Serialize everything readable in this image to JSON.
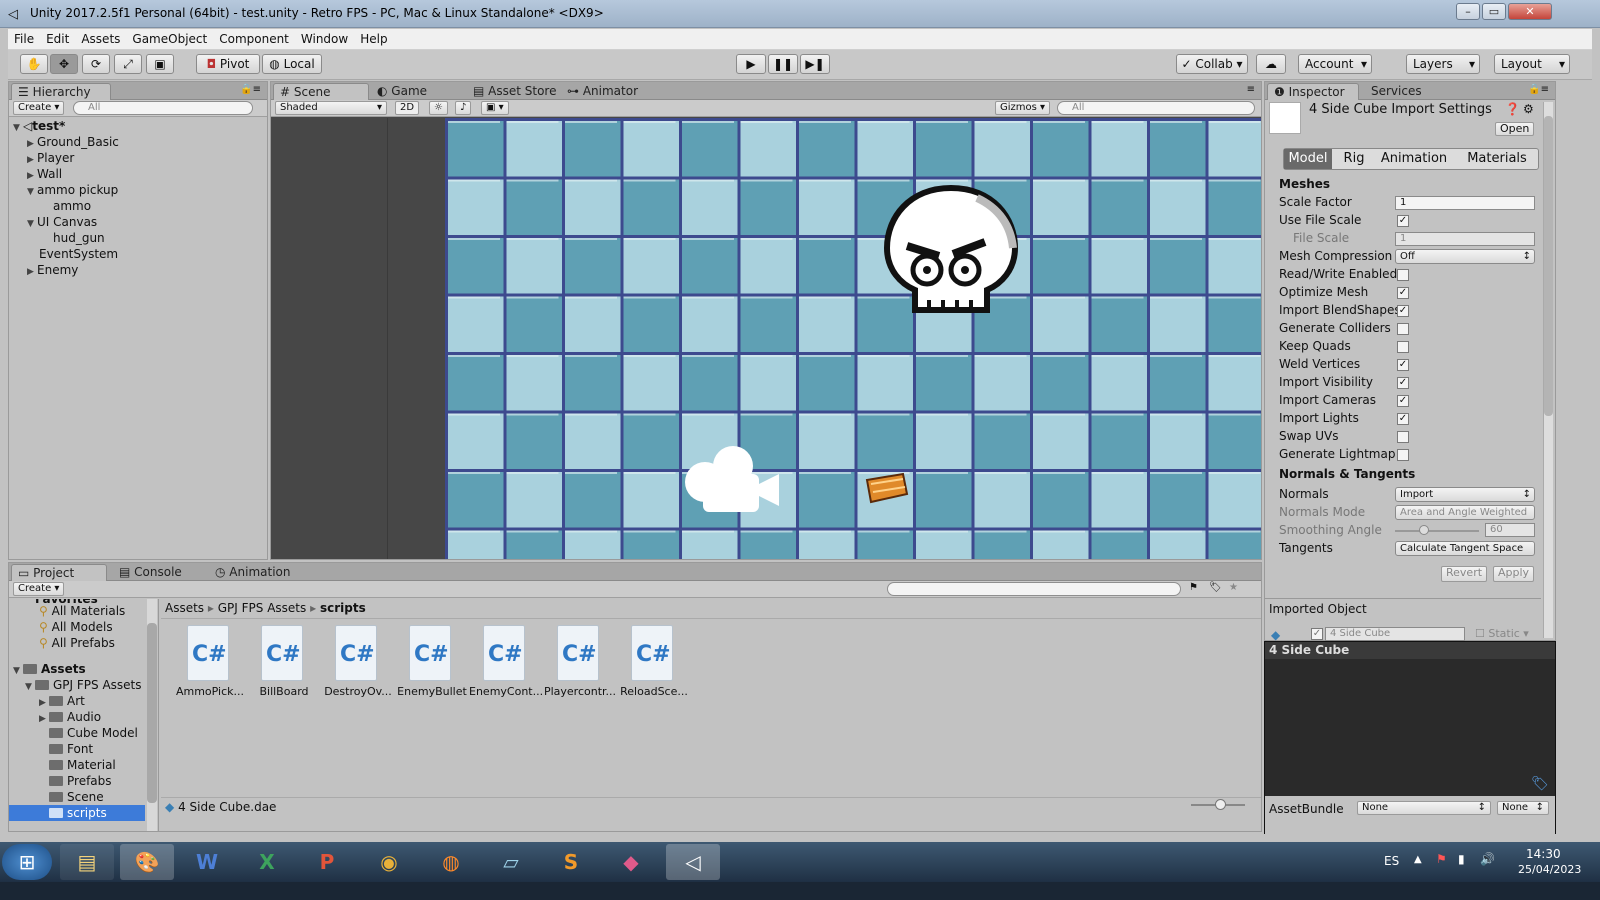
{
  "window": {
    "title": "Unity 2017.2.5f1 Personal (64bit) - test.unity - Retro FPS - PC, Mac & Linux Standalone* <DX9>"
  },
  "menu": [
    "File",
    "Edit",
    "Assets",
    "GameObject",
    "Component",
    "Window",
    "Help"
  ],
  "toolbar": {
    "pivot": "Pivot",
    "local": "Local",
    "collab": "Collab",
    "account": "Account",
    "layers": "Layers",
    "layout": "Layout"
  },
  "hierarchy": {
    "tab": "Hierarchy",
    "create": "Create",
    "search_placeholder": "All",
    "scene": "test*",
    "items": [
      "Ground_Basic",
      "Player",
      "Wall",
      "ammo pickup",
      "ammo",
      "UI Canvas",
      "hud_gun",
      "EventSystem",
      "Enemy"
    ]
  },
  "scene_tabs": {
    "scene": "Scene",
    "game": "Game",
    "store": "Asset Store",
    "animator": "Animator"
  },
  "scene_toolbar": {
    "shaded": "Shaded",
    "mode2d": "2D",
    "gizmos": "Gizmos",
    "search_placeholder": "All"
  },
  "inspector": {
    "tab": "Inspector",
    "services": "Services",
    "title": "4 Side Cube Import Settings",
    "open": "Open",
    "subtabs": [
      "Model",
      "Rig",
      "Animation",
      "Materials"
    ],
    "meshes_header": "Meshes",
    "scale_factor_label": "Scale Factor",
    "scale_factor_value": "1",
    "use_file_scale_label": "Use File Scale",
    "use_file_scale": true,
    "file_scale_label": "File Scale",
    "file_scale_value": "1",
    "mesh_compression_label": "Mesh Compression",
    "mesh_compression_value": "Off",
    "rw_label": "Read/Write Enabled",
    "rw": false,
    "optimize_label": "Optimize Mesh",
    "optimize": true,
    "blend_label": "Import BlendShapes",
    "blend": true,
    "colliders_label": "Generate Colliders",
    "colliders": false,
    "quads_label": "Keep Quads",
    "quads": false,
    "weld_label": "Weld Vertices",
    "weld": true,
    "visibility_label": "Import Visibility",
    "visibility": true,
    "cameras_label": "Import Cameras",
    "cameras": true,
    "lights_label": "Import Lights",
    "lights": true,
    "swap_label": "Swap UVs",
    "swap": false,
    "lightmap_label": "Generate Lightmap U",
    "lightmap": false,
    "normals_header": "Normals & Tangents",
    "normals_label": "Normals",
    "normals_value": "Import",
    "normals_mode_label": "Normals Mode",
    "normals_mode_value": "Area and Angle Weighted",
    "smoothing_label": "Smoothing Angle",
    "smoothing_value": "60",
    "tangents_label": "Tangents",
    "tangents_value": "Calculate Tangent Space",
    "revert": "Revert",
    "apply": "Apply",
    "imported_object": "Imported Object",
    "object_name": "4 Side Cube",
    "static": "Static",
    "preview_title": "4 Side Cube",
    "assetbundle_label": "AssetBundle",
    "assetbundle_value": "None",
    "assetbundle_variant": "None"
  },
  "project": {
    "tabs": [
      "Project",
      "Console",
      "Animation"
    ],
    "create": "Create",
    "favorites_header": "Favorites",
    "favorites": [
      "All Materials",
      "All Models",
      "All Prefabs"
    ],
    "assets_header": "Assets",
    "gpj": "GPJ FPS Assets",
    "folders": [
      "Art",
      "Audio",
      "Cube Model",
      "Font",
      "Material",
      "Prefabs",
      "Scene",
      "scripts"
    ],
    "breadcrumb": [
      "Assets",
      "GPJ FPS Assets",
      "scripts"
    ],
    "files": [
      "AmmoPick...",
      "BillBoard",
      "DestroyOv...",
      "EnemyBullet",
      "EnemyCont...",
      "Playercontr...",
      "ReloadSce..."
    ],
    "file_glyph": "C#",
    "selected_file": "4 Side Cube.dae"
  },
  "taskbar": {
    "lang": "ES",
    "time": "14:30",
    "date": "25/04/2023"
  },
  "colors": {
    "tile_dark": "#5fa0b4",
    "tile_light": "#a9d1dd",
    "grid": "#3d4a8e",
    "editor_bg": "#c2c2c2",
    "selection": "#3d7bd9"
  }
}
